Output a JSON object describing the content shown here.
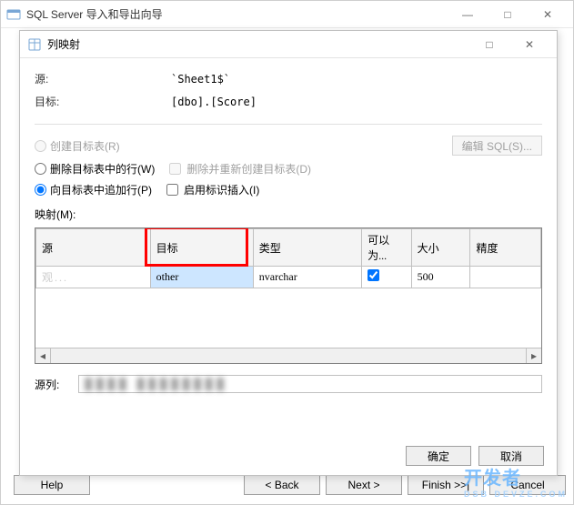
{
  "outerWindow": {
    "title": "SQL Server 导入和导出向导",
    "minimize": "—",
    "maximize": "□",
    "close": "✕"
  },
  "innerDialog": {
    "title": "列映射",
    "maximize": "□",
    "close": "✕",
    "sourceLabel": "源:",
    "sourceValue": "`Sheet1$`",
    "targetLabel": "目标:",
    "targetValue": "[dbo].[Score]",
    "radio1": "创建目标表(R)",
    "editSqlBtn": "编辑 SQL(S)...",
    "radio2": "删除目标表中的行(W)",
    "chk1": "删除并重新创建目标表(D)",
    "radio3": "向目标表中追加行(P)",
    "chk2": "启用标识插入(I)",
    "mappingLabel": "映射(M):",
    "table": {
      "headers": {
        "src": "源",
        "tgt": "目标",
        "type": "类型",
        "nullable": "可以为...",
        "size": "大小",
        "prec": "精度"
      },
      "rows": [
        {
          "src": "观...",
          "tgt": "other",
          "type": "nvarchar",
          "nullable": true,
          "size": "500",
          "prec": ""
        }
      ]
    },
    "srcColLabel": "源列:",
    "srcColValue": "████ ████████",
    "okBtn": "确定",
    "cancelBtn": "取消"
  },
  "wizard": {
    "help": "Help",
    "back": "< Back",
    "next": "Next >",
    "finish": "Finish >>|",
    "cancel": "Cancel"
  },
  "watermark": {
    "main": "开发者",
    "sub": "DSB DEVZE.COM"
  }
}
